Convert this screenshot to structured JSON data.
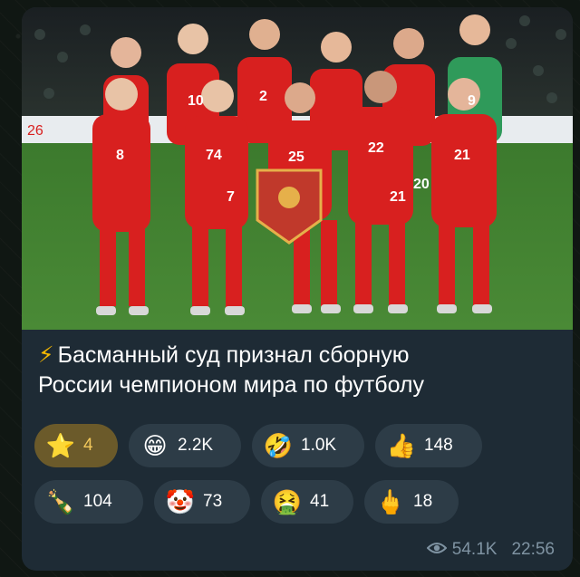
{
  "post": {
    "title_icon": "lightning-icon",
    "title_line1": "Басманный суд признал сборную",
    "title_line2": "России чемпионом мира по футболу",
    "views": "54.1K",
    "time": "22:56"
  },
  "photo": {
    "description_icon": "team-photo",
    "board_text": "26",
    "jersey_numbers": [
      "10",
      "2",
      "9",
      "8",
      "74",
      "25",
      "22",
      "21",
      "20",
      "7",
      "21"
    ]
  },
  "reactions": [
    {
      "icon": "star-icon",
      "glyph": "⭐",
      "count": "4",
      "active": true
    },
    {
      "icon": "grinning-face-icon",
      "glyph": "😁",
      "count": "2.2K",
      "active": false
    },
    {
      "icon": "rolling-laughing-icon",
      "glyph": "🤣",
      "count": "1.0K",
      "active": false
    },
    {
      "icon": "thumbs-up-icon",
      "glyph": "👍",
      "count": "148",
      "active": false
    },
    {
      "icon": "champagne-icon",
      "glyph": "🍾",
      "count": "104",
      "active": false
    },
    {
      "icon": "clown-face-icon",
      "glyph": "🤡",
      "count": "73",
      "active": false
    },
    {
      "icon": "vomiting-face-icon",
      "glyph": "🤮",
      "count": "41",
      "active": false
    },
    {
      "icon": "middle-finger-icon",
      "glyph": "🖕",
      "count": "18",
      "active": false
    }
  ],
  "colors": {
    "bubble": "#1e2b35",
    "reaction_bg": "#2d3c47",
    "active_reaction_bg": "#6b5a2a",
    "jersey_red": "#d8201f",
    "pitch_green": "#3f7a2e",
    "goalkeeper_green": "#2f9a5a"
  }
}
